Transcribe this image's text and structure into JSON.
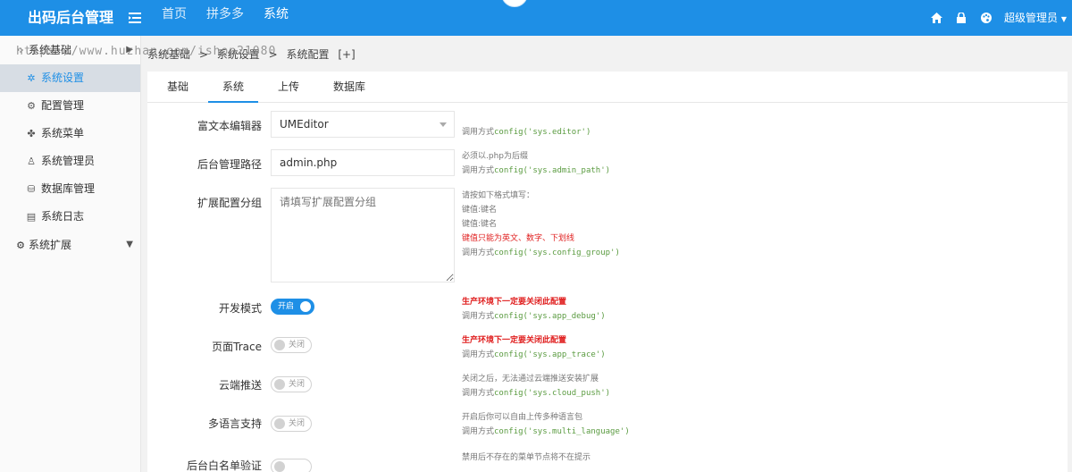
{
  "header": {
    "brand": "出码后台管理",
    "nav": [
      "首页",
      "拼多多",
      "系统"
    ],
    "user": "超级管理员"
  },
  "watermark": "https://www.huzhan.com/ishop21080",
  "sidebar": {
    "group1": "系统基础",
    "items": [
      "系统设置",
      "配置管理",
      "系统菜单",
      "系统管理员",
      "数据库管理",
      "系统日志"
    ],
    "group2": "系统扩展"
  },
  "breadcrumb": {
    "items": [
      "系统基础",
      ">",
      "系统设置",
      ">",
      "系统配置",
      "[+]"
    ]
  },
  "tabs": [
    "基础",
    "系统",
    "上传",
    "数据库"
  ],
  "form": {
    "editor": {
      "label": "富文本编辑器",
      "value": "UMEditor",
      "tip_call": "调用方式",
      "tip_code": "config('sys.editor')"
    },
    "admin_path": {
      "label": "后台管理路径",
      "value": "admin.php",
      "tip1": "必须以.php为后缀",
      "tip_call": "调用方式",
      "tip_code": "config('sys.admin_path')"
    },
    "config_group": {
      "label": "扩展配置分组",
      "placeholder": "请填写扩展配置分组",
      "tip1": "请按如下格式填写：",
      "tip2": "键值:键名",
      "tip3": "键值:键名",
      "tip4": "键值只能为英文、数字、下划线",
      "tip_call": "调用方式",
      "tip_code": "config('sys.config_group')"
    },
    "app_debug": {
      "label": "开发模式",
      "state": "开启",
      "tip1": "生产环境下一定要关闭此配置",
      "tip_call": "调用方式",
      "tip_code": "config('sys.app_debug')"
    },
    "app_trace": {
      "label": "页面Trace",
      "state": "关闭",
      "tip1": "生产环境下一定要关闭此配置",
      "tip_call": "调用方式",
      "tip_code": "config('sys.app_trace')"
    },
    "cloud_push": {
      "label": "云端推送",
      "state": "关闭",
      "tip1": "关闭之后，无法通过云端推送安装扩展",
      "tip_call": "调用方式",
      "tip_code": "config('sys.cloud_push')"
    },
    "multi_language": {
      "label": "多语言支持",
      "state": "关闭",
      "tip1": "开启后你可以自由上传多种语言包",
      "tip_call": "调用方式",
      "tip_code": "config('sys.multi_language')"
    },
    "partial": {
      "label": "后台白名单验证",
      "tip1": "禁用后不存在的菜单节点将不在提示"
    }
  },
  "colors": {
    "primary": "#1E8FE6",
    "warning": "#e02020",
    "code": "#5a9b40"
  }
}
